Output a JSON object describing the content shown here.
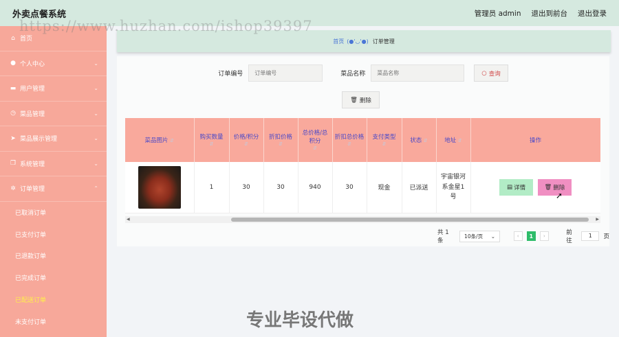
{
  "header": {
    "title": "外卖点餐系统",
    "user": "管理员 admin",
    "front_link": "退出到前台",
    "logout": "退出登录"
  },
  "sidebar": {
    "items": [
      {
        "label": "首页",
        "icon": "home-icon",
        "glyph": "⌂",
        "arrow": ""
      },
      {
        "label": "个人中心",
        "icon": "user-icon",
        "glyph": "●",
        "arrow": "⌄"
      },
      {
        "label": "用户管理",
        "icon": "briefcase-icon",
        "glyph": "▬",
        "arrow": "⌄"
      },
      {
        "label": "菜品管理",
        "icon": "clock-icon",
        "glyph": "◷",
        "arrow": "⌄"
      },
      {
        "label": "菜品展示管理",
        "icon": "send-icon",
        "glyph": "➤",
        "arrow": "⌄"
      },
      {
        "label": "系统管理",
        "icon": "copy-icon",
        "glyph": "❐",
        "arrow": "⌄"
      },
      {
        "label": "订单管理",
        "icon": "settings-icon",
        "glyph": "✲",
        "arrow": "⌃"
      }
    ],
    "sub_items": [
      {
        "label": "已取消订单",
        "active": false
      },
      {
        "label": "已支付订单",
        "active": false
      },
      {
        "label": "已退款订单",
        "active": false
      },
      {
        "label": "已完成订单",
        "active": false
      },
      {
        "label": "已配送订单",
        "active": true
      },
      {
        "label": "未支付订单",
        "active": false
      }
    ]
  },
  "breadcrumb": {
    "home": "首页",
    "face": "(●'◡'●)",
    "current": "订单管理"
  },
  "search": {
    "order_no_label": "订单编号",
    "order_no_placeholder": "订单编号",
    "dish_name_label": "菜品名称",
    "dish_name_placeholder": "菜品名称",
    "search_button": "查询",
    "delete_button": "删除"
  },
  "table": {
    "columns": [
      "菜品图片",
      "购买数量",
      "价格/积分",
      "折扣价格",
      "总价格/总积分",
      "折扣总价格",
      "支付类型",
      "状态",
      "地址",
      "操作"
    ],
    "rows": [
      {
        "quantity": "1",
        "price": "30",
        "discount_price": "30",
        "total_price": "940",
        "discount_total": "30",
        "pay_type": "现金",
        "status": "已派送",
        "address": "宇宙银河系金星1号",
        "detail_button": "详情",
        "delete_button": "删除"
      }
    ]
  },
  "pagination": {
    "total": "共 1 条",
    "page_size": "10条/页",
    "current_page": "1",
    "goto_label": "前往",
    "goto_value": "1",
    "page_suffix": "页"
  },
  "watermarks": {
    "top": "https://www.huzhan.com/ishop39397",
    "bottom": "专业毕设代做"
  },
  "colors": {
    "topbar": "#d5e9df",
    "sidebar": "#f7a89a",
    "table_header": "#f9a99c",
    "pager_active": "#2ebc6a"
  }
}
